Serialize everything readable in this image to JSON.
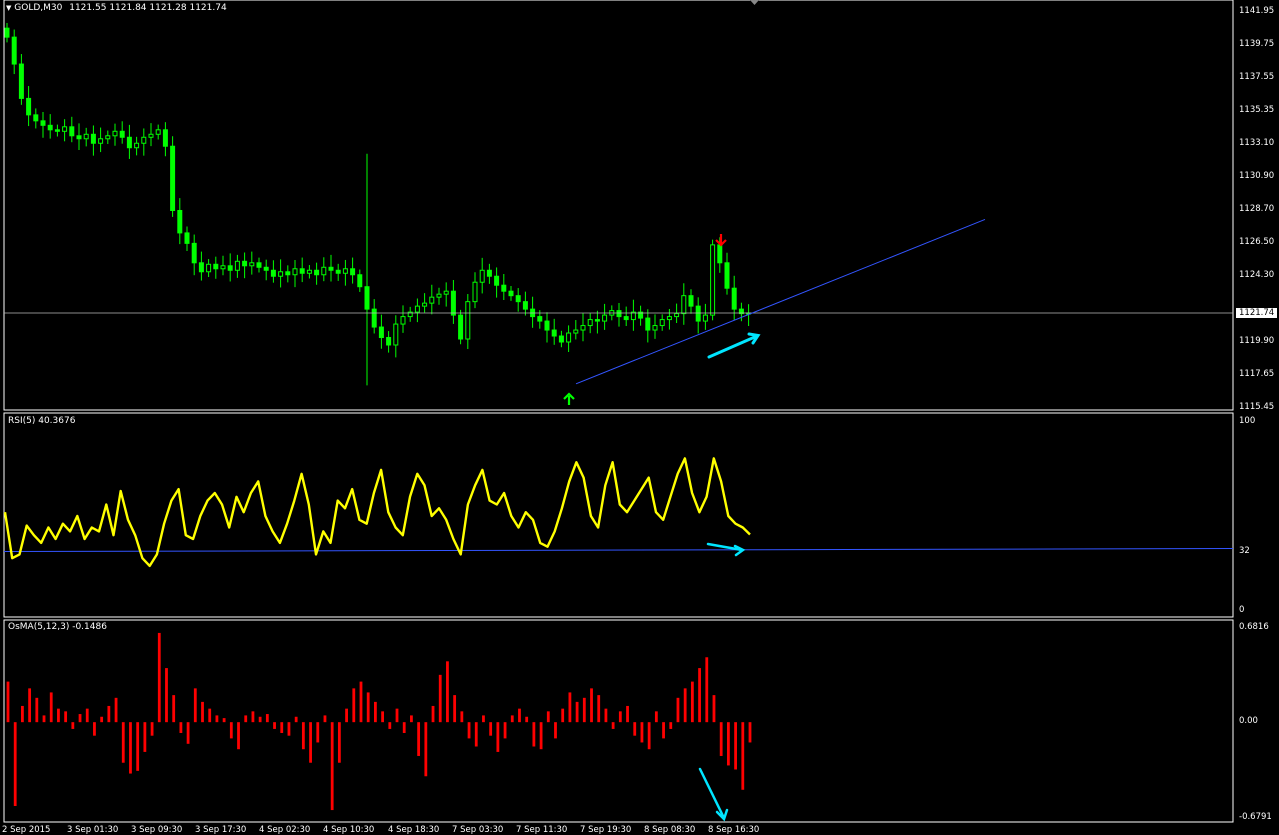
{
  "header": {
    "symbol": "GOLD,M30",
    "ohlc": "1121.55 1121.84 1121.28 1121.74"
  },
  "price_axis": {
    "ticks": [
      "1141.95",
      "1139.75",
      "1137.55",
      "1135.35",
      "1133.10",
      "1130.90",
      "1128.70",
      "1126.50",
      "1124.30",
      "1119.90",
      "1117.65",
      "1115.45"
    ],
    "current": "1121.74"
  },
  "rsi_panel": {
    "title": "RSI(5) 40.3676",
    "ticks": [
      "100",
      "32",
      "0"
    ]
  },
  "osma_panel": {
    "title": "OsMA(5,12,3) -0.1486",
    "ticks": [
      "0.6816",
      "0.00",
      "-0.6791"
    ]
  },
  "time_axis": [
    "2 Sep 2015",
    "3 Sep 01:30",
    "3 Sep 09:30",
    "3 Sep 17:30",
    "4 Sep 02:30",
    "4 Sep 10:30",
    "4 Sep 18:30",
    "7 Sep 03:30",
    "7 Sep 11:30",
    "7 Sep 19:30",
    "8 Sep 08:30",
    "8 Sep 16:30"
  ],
  "colors": {
    "background": "#000000",
    "candles": "#00ff00",
    "rsi_line": "#ffff00",
    "osma_bars": "#ff0000",
    "trendline": "#3355ff",
    "annotation_arrow": "#00e5ff",
    "signal_up": "#00ff00",
    "signal_down": "#ff0000",
    "grid_frame": "#ffffff"
  },
  "chart_data": [
    {
      "type": "candlestick",
      "title": "GOLD,M30",
      "ylim": [
        1115.45,
        1141.95
      ],
      "close": [
        1140.2,
        1138.4,
        1136.1,
        1135.0,
        1134.6,
        1134.3,
        1134.0,
        1133.9,
        1134.2,
        1133.6,
        1133.4,
        1133.7,
        1133.1,
        1133.4,
        1133.6,
        1133.9,
        1133.5,
        1132.8,
        1133.1,
        1133.5,
        1133.7,
        1134.0,
        1132.9,
        1128.6,
        1127.1,
        1126.4,
        1125.1,
        1124.5,
        1125.0,
        1124.7,
        1124.9,
        1124.6,
        1125.2,
        1124.9,
        1125.1,
        1124.8,
        1124.6,
        1124.2,
        1124.5,
        1124.3,
        1124.7,
        1124.4,
        1124.6,
        1124.3,
        1124.8,
        1124.6,
        1124.4,
        1124.7,
        1124.3,
        1123.5,
        1122.0,
        1120.8,
        1120.1,
        1119.6,
        1121.0,
        1121.5,
        1121.8,
        1122.2,
        1122.4,
        1122.8,
        1123.0,
        1123.2,
        1121.6,
        1120.0,
        1122.5,
        1123.8,
        1124.6,
        1124.2,
        1123.6,
        1123.2,
        1122.9,
        1122.5,
        1122.0,
        1121.5,
        1121.2,
        1120.6,
        1120.2,
        1119.8,
        1120.4,
        1120.6,
        1120.9,
        1121.3,
        1121.2,
        1121.6,
        1121.9,
        1121.5,
        1121.3,
        1121.8,
        1121.4,
        1120.6,
        1120.9,
        1121.3,
        1121.5,
        1121.7,
        1122.9,
        1122.2,
        1121.2,
        1121.6,
        1126.3,
        1125.1,
        1123.4,
        1122.0,
        1121.7,
        1121.74
      ],
      "annotations": [
        "up arrow at low near 7 Sep 11:30",
        "down arrow at high near 8 Sep 16:30",
        "ascending trendline through lows",
        "cyan arrow up"
      ]
    },
    {
      "type": "line",
      "title": "RSI(5) 40.3676",
      "ylim": [
        0,
        100
      ],
      "level": 32,
      "values": [
        52,
        28,
        30,
        45,
        40,
        36,
        44,
        38,
        46,
        42,
        50,
        38,
        44,
        42,
        56,
        40,
        63,
        48,
        40,
        28,
        24,
        30,
        46,
        58,
        64,
        40,
        38,
        50,
        58,
        62,
        56,
        44,
        60,
        52,
        62,
        68,
        50,
        42,
        36,
        46,
        58,
        72,
        56,
        30,
        42,
        36,
        58,
        54,
        64,
        48,
        46,
        62,
        74,
        52,
        44,
        40,
        60,
        72,
        66,
        50,
        54,
        48,
        38,
        30,
        56,
        66,
        74,
        58,
        56,
        62,
        50,
        44,
        52,
        48,
        36,
        34,
        42,
        54,
        68,
        78,
        70,
        50,
        44,
        66,
        78,
        56,
        52,
        58,
        64,
        70,
        52,
        48,
        60,
        72,
        80,
        62,
        52,
        60,
        80,
        68,
        50,
        46,
        44,
        40.37
      ]
    },
    {
      "type": "bar",
      "title": "OsMA(5,12,3) -0.1486",
      "ylim": [
        -0.6791,
        0.6816
      ],
      "values": [
        0.3,
        -0.62,
        0.12,
        0.25,
        0.18,
        0.05,
        0.22,
        0.1,
        0.08,
        -0.05,
        0.06,
        0.1,
        -0.1,
        0.04,
        0.12,
        0.18,
        -0.3,
        -0.38,
        -0.36,
        -0.22,
        -0.1,
        0.66,
        0.4,
        0.2,
        -0.08,
        -0.16,
        0.25,
        0.15,
        0.1,
        0.05,
        0.03,
        -0.12,
        -0.2,
        0.05,
        0.08,
        0.04,
        0.06,
        -0.05,
        -0.08,
        -0.1,
        0.04,
        -0.2,
        -0.3,
        -0.15,
        0.05,
        -0.65,
        -0.3,
        0.1,
        0.25,
        0.3,
        0.22,
        0.15,
        0.08,
        -0.05,
        0.1,
        -0.08,
        0.05,
        -0.25,
        -0.4,
        0.12,
        0.35,
        0.45,
        0.2,
        0.08,
        -0.12,
        -0.18,
        0.05,
        -0.1,
        -0.22,
        -0.12,
        0.05,
        0.1,
        0.04,
        -0.18,
        -0.2,
        0.08,
        -0.12,
        0.1,
        0.22,
        0.15,
        0.18,
        0.25,
        0.2,
        0.1,
        -0.05,
        0.08,
        0.12,
        -0.1,
        -0.15,
        -0.2,
        0.08,
        -0.12,
        -0.05,
        0.18,
        0.25,
        0.3,
        0.4,
        0.48,
        0.2,
        -0.25,
        -0.32,
        -0.35,
        -0.5,
        -0.15
      ]
    }
  ]
}
